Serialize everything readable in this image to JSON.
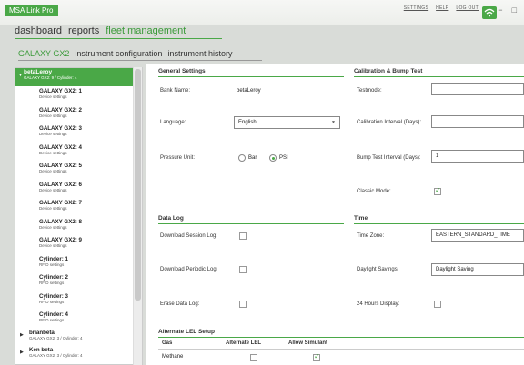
{
  "app": {
    "title": "MSA Link Pro"
  },
  "top_links": [
    "SETTINGS",
    "HELP",
    "LOG OUT"
  ],
  "window_controls": [
    "−",
    "□"
  ],
  "main_nav": [
    {
      "label": "dashboard",
      "active": false
    },
    {
      "label": "reports",
      "active": false
    },
    {
      "label": "fleet management",
      "active": true
    }
  ],
  "sub_nav": [
    {
      "label": "GALAXY GX2",
      "active": true
    },
    {
      "label": "instrument configuration",
      "active": false
    },
    {
      "label": "instrument history",
      "active": false
    }
  ],
  "sidebar": {
    "selected": {
      "name": "betaLeroy",
      "sub": "GALAXY GX2: 9 / Cylinder: 4"
    },
    "items": [
      {
        "name": "GALAXY GX2: 1",
        "sub": "Device settings"
      },
      {
        "name": "GALAXY GX2: 2",
        "sub": "Device settings"
      },
      {
        "name": "GALAXY GX2: 3",
        "sub": "Device settings"
      },
      {
        "name": "GALAXY GX2: 4",
        "sub": "Device settings"
      },
      {
        "name": "GALAXY GX2: 5",
        "sub": "Device settings"
      },
      {
        "name": "GALAXY GX2: 6",
        "sub": "Device settings"
      },
      {
        "name": "GALAXY GX2: 7",
        "sub": "Device settings"
      },
      {
        "name": "GALAXY GX2: 8",
        "sub": "Device settings"
      },
      {
        "name": "GALAXY GX2: 9",
        "sub": "Device settings"
      },
      {
        "name": "Cylinder: 1",
        "sub": "RFID settings"
      },
      {
        "name": "Cylinder: 2",
        "sub": "RFID settings"
      },
      {
        "name": "Cylinder: 3",
        "sub": "RFID settings"
      },
      {
        "name": "Cylinder: 4",
        "sub": "RFID settings"
      }
    ],
    "groups": [
      {
        "name": "brianbeta",
        "sub": "GALAXY GX2: 3 / Cylinder: 4"
      },
      {
        "name": "Ken beta",
        "sub": "GALAXY GX2: 3 / Cylinder: 4"
      }
    ]
  },
  "general": {
    "title": "General Settings",
    "bank_name_label": "Bank Name:",
    "bank_name_value": "betaLeroy",
    "language_label": "Language:",
    "language_value": "English",
    "pressure_label": "Pressure Unit:",
    "pressure_bar": "Bar",
    "pressure_psi": "PSI",
    "pressure_selected": "PSI"
  },
  "calibration": {
    "title": "Calibration & Bump Test",
    "testmode_label": "Testmode:",
    "testmode_value": "",
    "cal_interval_label": "Calibration Interval (Days):",
    "cal_interval_value": "",
    "bump_interval_label": "Bump Test Interval (Days):",
    "bump_interval_value": "1",
    "classic_label": "Classic Mode:",
    "classic_checked": true
  },
  "datalog": {
    "title": "Data Log",
    "session_label": "Download Session Log:",
    "session_checked": false,
    "periodic_label": "Download Periodic Log:",
    "periodic_checked": false,
    "erase_label": "Erase Data Log:",
    "erase_checked": false
  },
  "time": {
    "title": "Time",
    "zone_label": "Time Zone:",
    "zone_value": "EASTERN_STANDARD_TIME",
    "dst_label": "Daylight Savings:",
    "dst_value": "Daylight Saving",
    "h24_label": "24 Hours Display:",
    "h24_checked": false
  },
  "lel": {
    "title": "Alternate LEL Setup",
    "headers": [
      "Gas",
      "Alternate LEL",
      "Allow Simulant"
    ],
    "rows": [
      {
        "gas": "Methane",
        "alternate": false,
        "simulant": true
      }
    ]
  },
  "colors": {
    "accent": "#4aa847"
  }
}
